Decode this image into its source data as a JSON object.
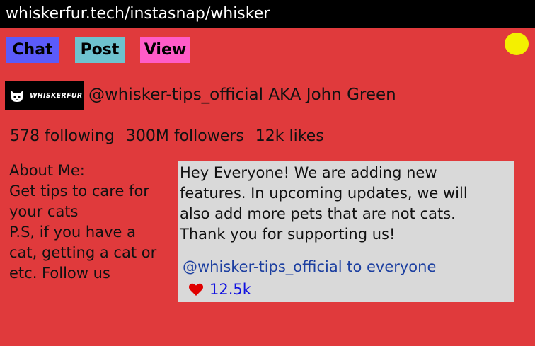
{
  "browser": {
    "url": "whiskerfur.tech/instasnap/whisker"
  },
  "nav": {
    "chat_label": "Chat",
    "post_label": "Post",
    "view_label": "View"
  },
  "profile": {
    "logo_text": "WHISKERFUR",
    "logo_icon": "cat-face-icon",
    "handle_line": "@whisker-tips_official AKA John Green",
    "following": "578 following",
    "followers": "300M followers",
    "likes": "12k likes",
    "about_lines": [
      "About Me:",
      "Get tips to care for",
      "your cats",
      "P.S, if you have a",
      "cat, getting a cat or",
      "etc. Follow us"
    ]
  },
  "post": {
    "lines": [
      "Hey Everyone! We are adding new",
      "features. In upcoming updates, we will",
      "also add more pets that are not cats.",
      "Thank you for supporting us!"
    ],
    "author_line": "@whisker-tips_official to everyone",
    "like_count": "12.5k",
    "like_icon": "heart-icon"
  },
  "colors": {
    "background": "#e03a3c",
    "chat_button": "#5b5bfa",
    "post_button": "#6ec3cf",
    "view_button": "#ff5cc8",
    "status_dot": "#f4f000",
    "post_card": "#d9d9d9",
    "heart": "#e00000"
  }
}
